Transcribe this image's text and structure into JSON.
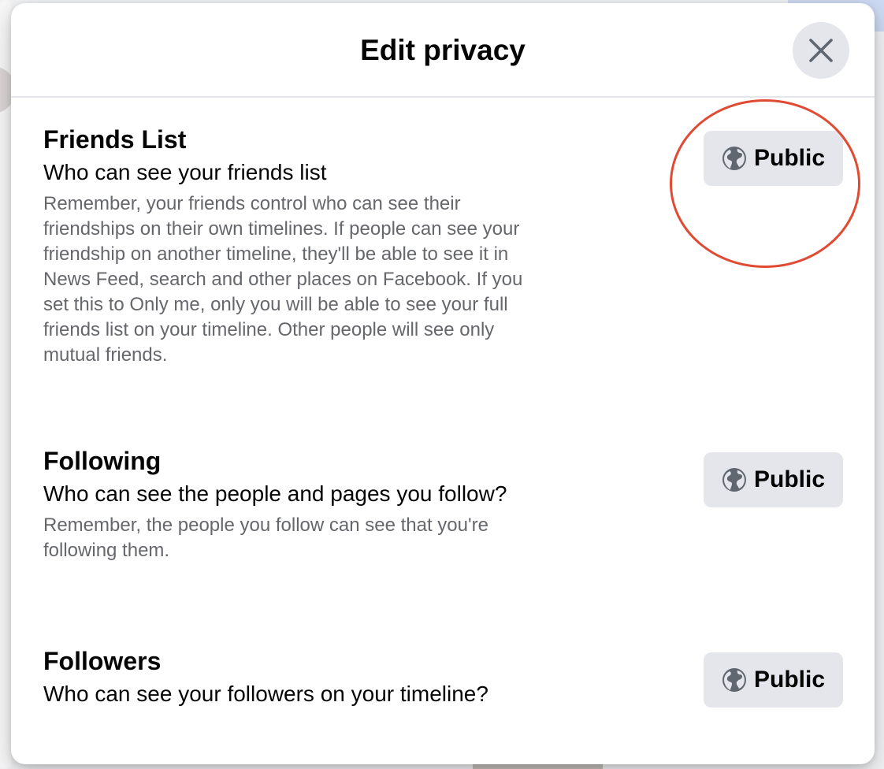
{
  "modal": {
    "title": "Edit privacy",
    "close_icon": "close-icon"
  },
  "sections": [
    {
      "title": "Friends List",
      "question": "Who can see your friends list",
      "description": "Remember, your friends control who can see their friendships on their own timelines. If people can see your friendship on another timeline, they'll be able to see it in News Feed, search and other places on Facebook. If you set this to Only me, only you will be able to see your full friends list on your timeline. Other people will see only mutual friends.",
      "privacy_label": "Public",
      "privacy_icon": "globe-icon"
    },
    {
      "title": "Following",
      "question": "Who can see the people and pages you follow?",
      "description": "Remember, the people you follow can see that you're following them.",
      "privacy_label": "Public",
      "privacy_icon": "globe-icon"
    },
    {
      "title": "Followers",
      "question": "Who can see your followers on your timeline?",
      "privacy_label": "Public",
      "privacy_icon": "globe-icon"
    }
  ],
  "colors": {
    "highlight_ring": "#e04b33",
    "button_bg": "#e4e6eb",
    "secondary_text": "#65676b"
  }
}
